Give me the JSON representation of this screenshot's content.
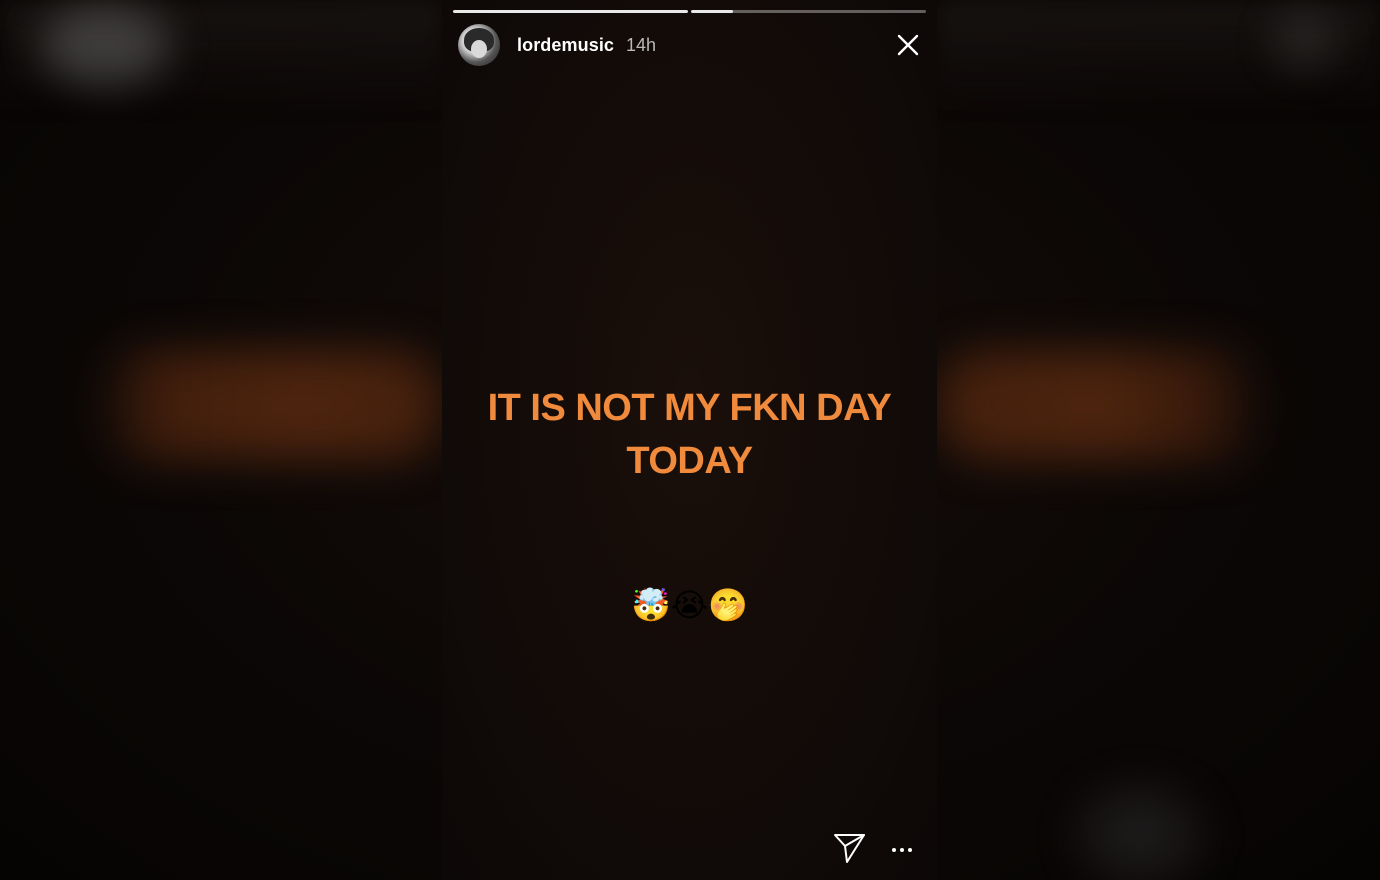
{
  "story": {
    "progress": [
      {
        "segment": 1,
        "fraction": 1.0
      },
      {
        "segment": 2,
        "fraction": 0.18
      }
    ],
    "header": {
      "username": "lordemusic",
      "time": "14h",
      "avatar_icon": "user-avatar",
      "close_icon": "close-icon"
    },
    "caption_line1": "IT IS NOT MY FKN DAY",
    "caption_line2": "TODAY",
    "caption_color": "#f08a3c",
    "emojis": "🤯😭🤭",
    "footer": {
      "send_icon": "send-icon",
      "more_icon": "more-options-icon"
    }
  },
  "colors": {
    "background": "#0a0605",
    "text_primary": "#ffffff",
    "text_secondary": "#b9b9b9",
    "accent": "#f08a3c"
  }
}
